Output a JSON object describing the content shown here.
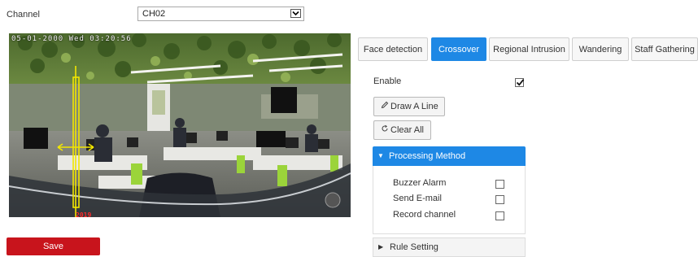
{
  "channel": {
    "label": "Channel",
    "selected": "CH02"
  },
  "video": {
    "osd_time": "05-01-2000 Wed 03:20:56",
    "osd_name": "2019"
  },
  "tabs": [
    {
      "label": "Face detection",
      "active": false
    },
    {
      "label": "Crossover",
      "active": true
    },
    {
      "label": "Regional Intrusion",
      "active": false
    },
    {
      "label": "Wandering",
      "active": false
    },
    {
      "label": "Staff Gathering",
      "active": false
    }
  ],
  "enable": {
    "label": "Enable",
    "checked": true
  },
  "buttons": {
    "draw_line": "Draw A Line",
    "clear_all": "Clear All",
    "save": "Save"
  },
  "processing": {
    "title": "Processing Method",
    "expanded": true,
    "options": [
      {
        "label": "Buzzer Alarm",
        "checked": false
      },
      {
        "label": "Send E-mail",
        "checked": false
      },
      {
        "label": "Record channel",
        "checked": false
      }
    ]
  },
  "rule_setting": {
    "title": "Rule Setting",
    "expanded": false
  },
  "colors": {
    "accent": "#1e88e5",
    "save": "#c8141c",
    "line": "#f2e600"
  }
}
